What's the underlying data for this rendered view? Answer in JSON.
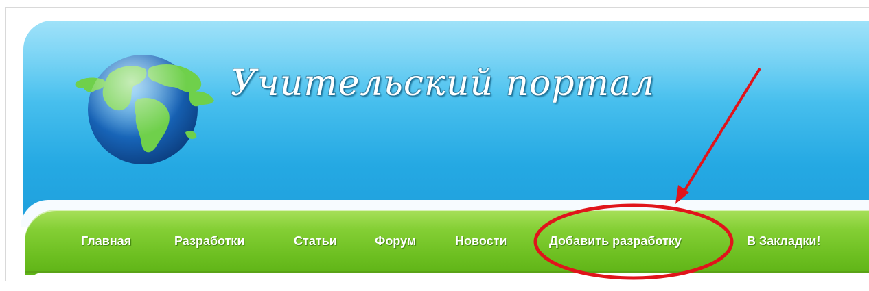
{
  "header": {
    "site_title": "Учительский портал"
  },
  "nav": {
    "items": [
      {
        "label": "Главная"
      },
      {
        "label": "Разработки"
      },
      {
        "label": "Статьи"
      },
      {
        "label": "Форум"
      },
      {
        "label": "Новости"
      },
      {
        "label": "Добавить разработку"
      },
      {
        "label": "В Закладки!"
      }
    ]
  },
  "annotation": {
    "highlighted_item": "Добавить разработку",
    "color": "#e0141b"
  },
  "colors": {
    "banner_blue": "#25a9e3",
    "nav_green": "#6dbf21",
    "text_white": "#ffffff"
  },
  "icons": {
    "logo": "globe-icon",
    "pointer": "arrow-annotation"
  }
}
